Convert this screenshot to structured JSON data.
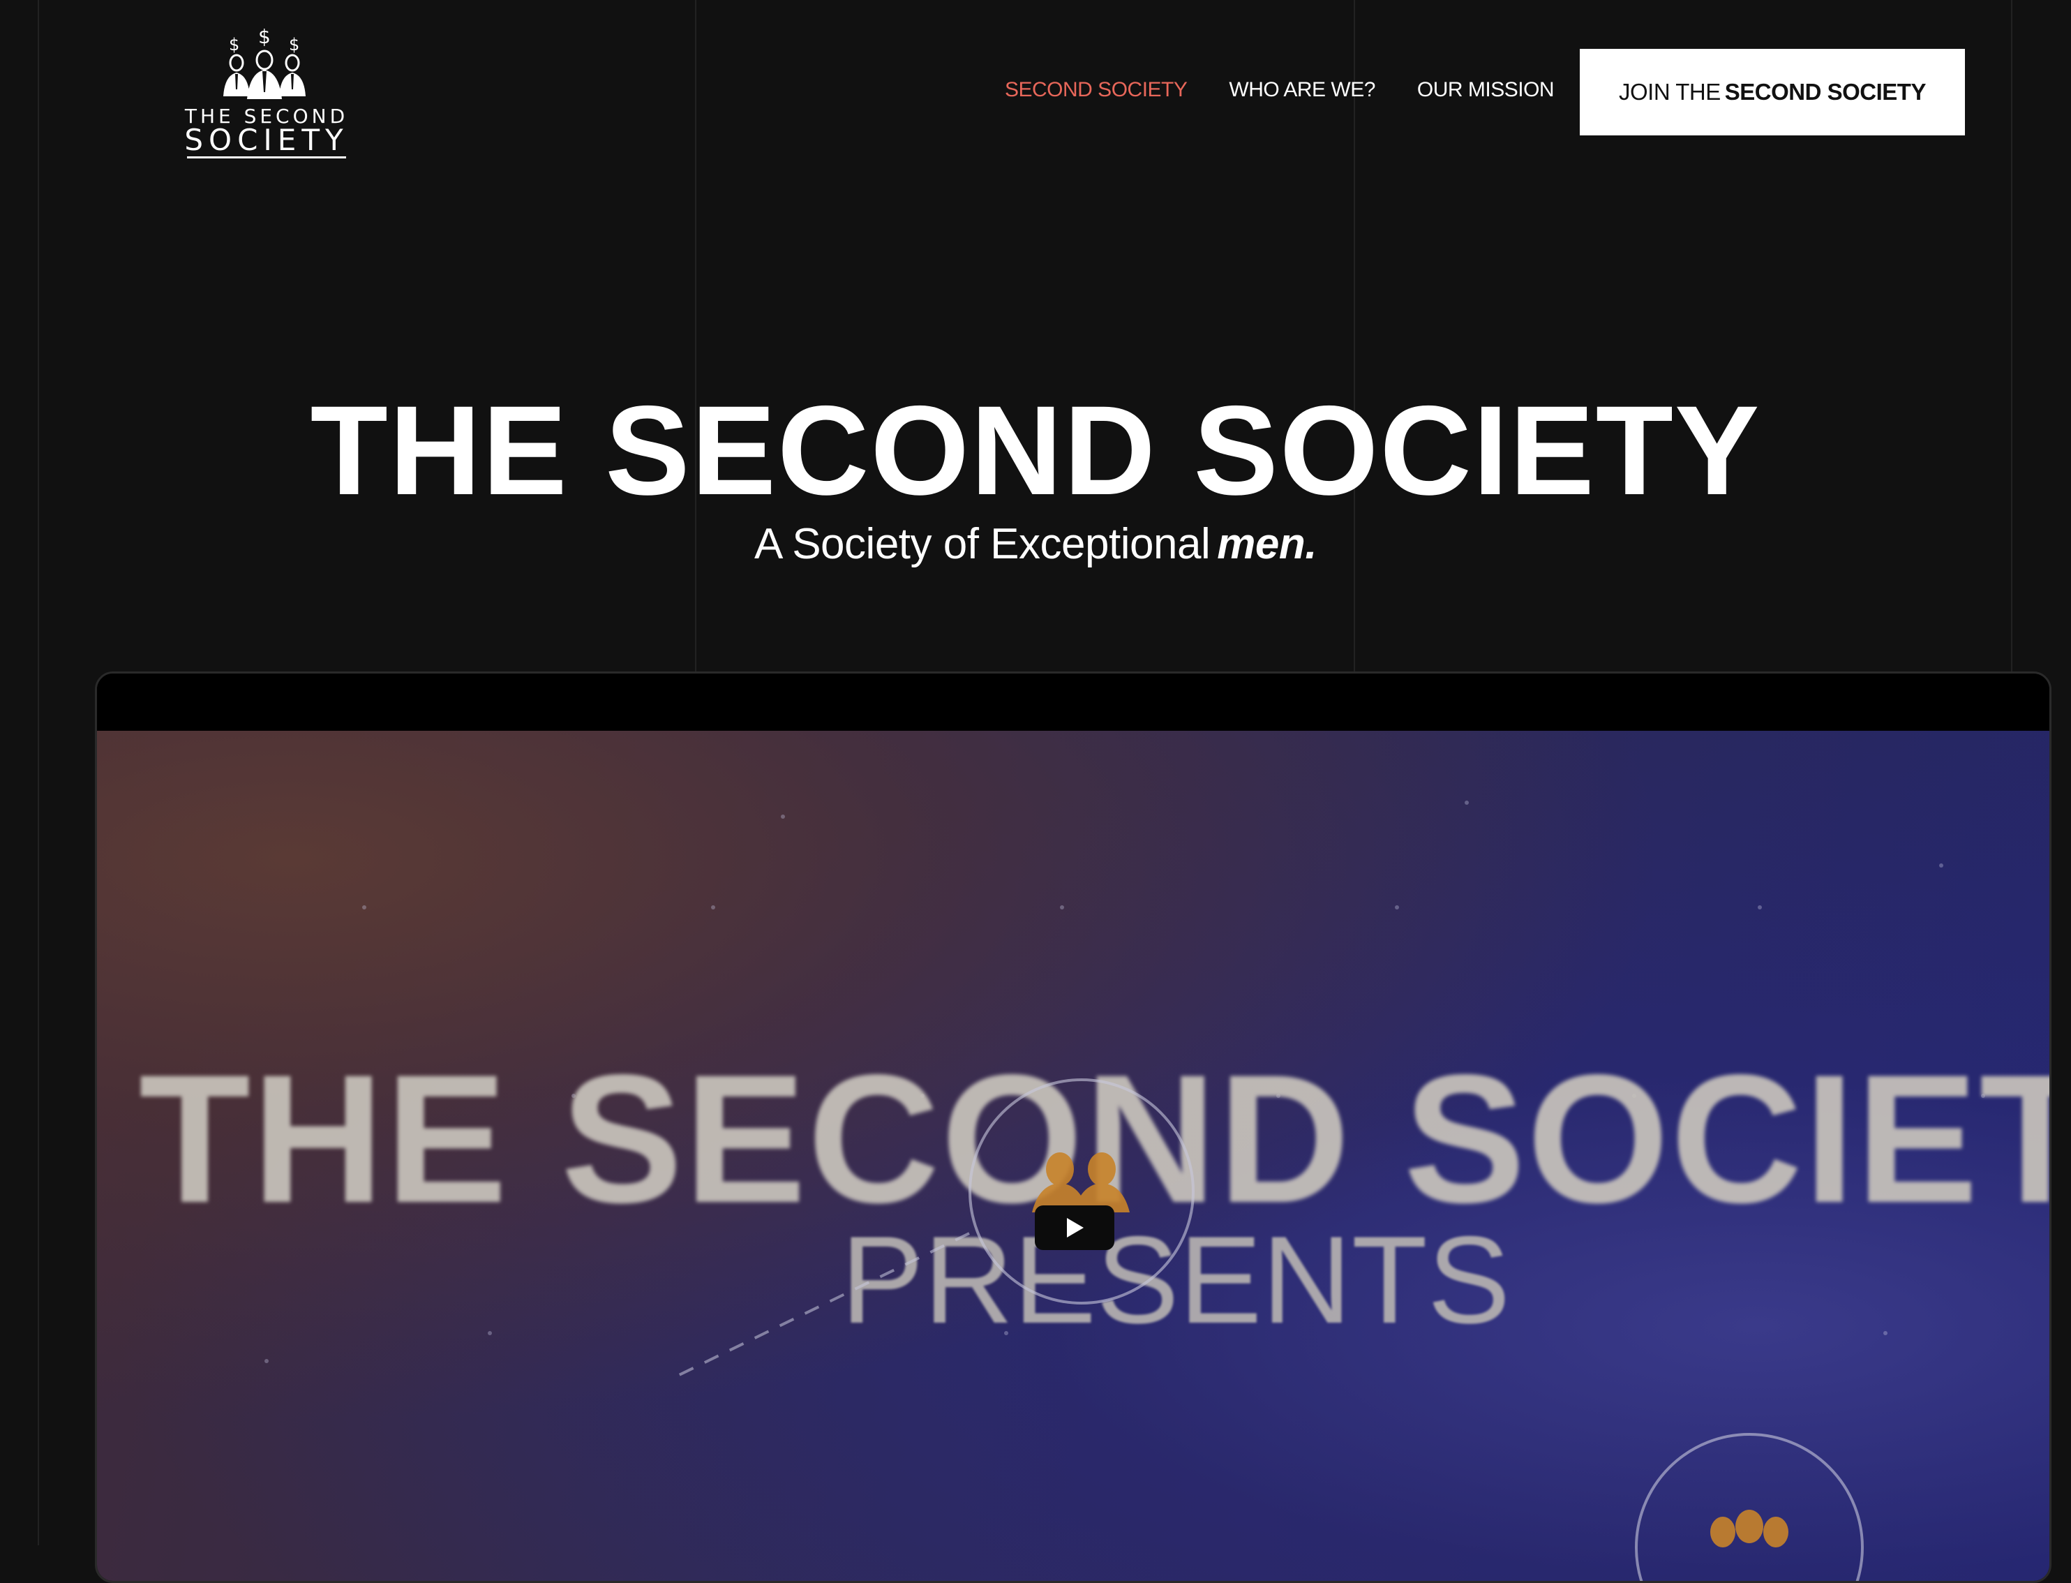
{
  "header": {
    "logo": {
      "line1": "THE SECOND",
      "line2": "SOCIETY"
    },
    "nav": [
      {
        "label": "SECOND SOCIETY",
        "active": true
      },
      {
        "label": "WHO ARE WE?",
        "active": false
      },
      {
        "label": "OUR MISSION",
        "active": false
      }
    ],
    "cta": {
      "label_prefix": "JOIN THE",
      "label_bold": "SECOND SOCIETY"
    }
  },
  "hero": {
    "title": "THE SECOND SOCIETY",
    "subtitle_prefix": "A Society of Exceptional",
    "subtitle_emphasis": "men."
  },
  "video": {
    "frame_title": "THE SECOND SOCIETY",
    "frame_subtitle": "PRESENTS",
    "play_icon": "play-icon"
  },
  "colors": {
    "background": "#111111",
    "accent": "#e8675a",
    "cta_bg": "#ffffff",
    "text": "#ffffff"
  }
}
